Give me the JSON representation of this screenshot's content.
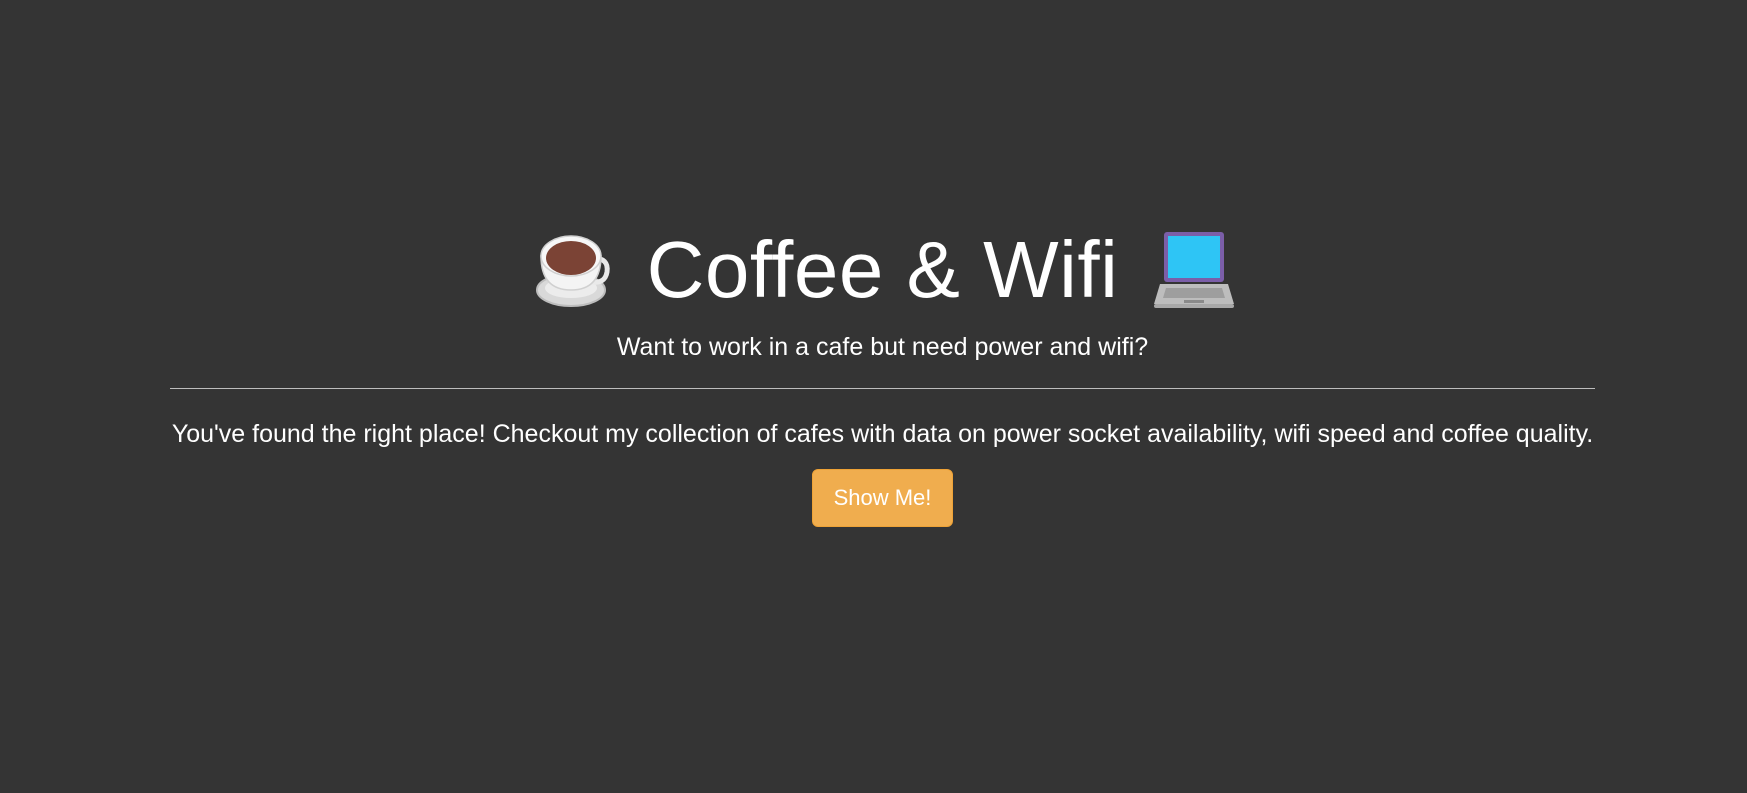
{
  "hero": {
    "title": "Coffee & Wifi",
    "left_icon": "coffee-cup-icon",
    "right_icon": "laptop-icon",
    "subtitle": "Want to work in a cafe but need power and wifi?",
    "body": "You've found the right place! Checkout my collection of cafes with data on power socket availability, wifi speed and coffee quality.",
    "button_label": "Show Me!"
  },
  "colors": {
    "background": "#343434",
    "text": "#ffffff",
    "button": "#f0ad4e",
    "divider": "#bdbdbd"
  }
}
